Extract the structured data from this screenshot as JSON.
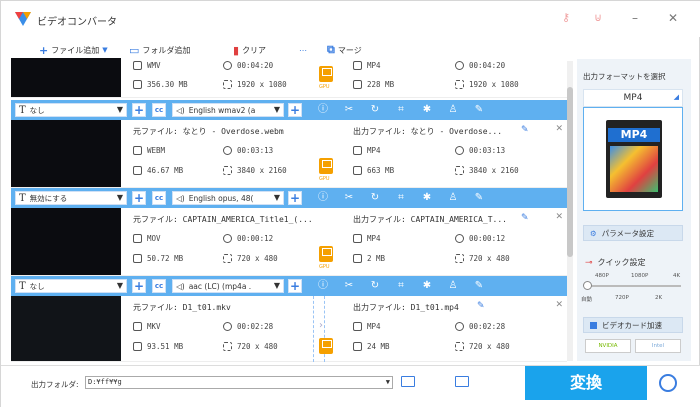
{
  "app": {
    "title": "ビデオコンバータ"
  },
  "toolbar": {
    "add_file": "ファイル追加",
    "add_folder": "フォルダ追加",
    "clear": "クリア",
    "merge": "マージ"
  },
  "rows": [
    {
      "src_title": "",
      "src_fmt": "WMV",
      "src_dur": "00:04:20",
      "src_size": "356.30 MB",
      "src_res": "1920 x 1080",
      "dst_title": "",
      "dst_fmt": "MP4",
      "dst_dur": "00:04:20",
      "dst_size": "228 MB",
      "dst_res": "1920 x 1080"
    },
    {
      "src_title": "元ファイル: なとり - Overdose.webm",
      "src_fmt": "WEBM",
      "src_dur": "00:03:13",
      "src_size": "46.67 MB",
      "src_res": "3840 x 2160",
      "dst_title": "出力ファイル: なとり - Overdose...",
      "dst_fmt": "MP4",
      "dst_dur": "00:03:13",
      "dst_size": "663 MB",
      "dst_res": "3840 x 2160"
    },
    {
      "src_title": "元ファイル: CAPTAIN_AMERICA_Title1_(...",
      "src_fmt": "MOV",
      "src_dur": "00:00:12",
      "src_size": "50.72 MB",
      "src_res": "720 x 480",
      "dst_title": "出力ファイル: CAPTAIN_AMERICA_T...",
      "dst_fmt": "MP4",
      "dst_dur": "00:00:12",
      "dst_size": "2 MB",
      "dst_res": "720 x 480"
    },
    {
      "src_title": "元ファイル: D1_t01.mkv",
      "src_fmt": "MKV",
      "src_dur": "00:02:28",
      "src_size": "93.51 MB",
      "src_res": "720 x 480",
      "dst_title": "出力ファイル: D1_t01.mp4",
      "dst_fmt": "MP4",
      "dst_dur": "00:02:28",
      "dst_size": "24 MB",
      "dst_res": "720 x 480"
    }
  ],
  "editbars": [
    {
      "subtitle": "なし",
      "audio": "English wmav2 (a"
    },
    {
      "subtitle": "無効にする",
      "audio": "English opus, 48("
    },
    {
      "subtitle": "なし",
      "audio": "aac (LC) (mp4a ."
    }
  ],
  "gpu_label": "GPU",
  "panel": {
    "format_title": "出力フォーマットを選択",
    "format": "MP4",
    "format_badge": "MP4",
    "param_btn": "パラメータ設定",
    "quick": "クイック設定",
    "q_top": [
      "480P",
      "1080P",
      "4K"
    ],
    "q_bottom": [
      "自動",
      "720P",
      "2K"
    ],
    "gpu_btn": "ビデオカード加速",
    "nvidia": "NVIDIA",
    "intel": "Intel"
  },
  "bottom": {
    "out_label": "出力フォルダ:",
    "out_path": "D:¥ff¥¥g",
    "convert": "変換"
  }
}
